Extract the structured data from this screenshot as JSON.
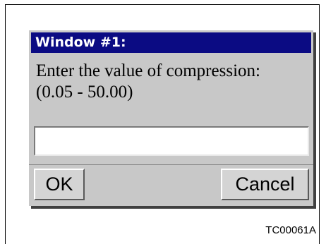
{
  "dialog": {
    "title": "Window #1:",
    "prompt_line1": "Enter the value of compression:",
    "prompt_line2": "(0.05 - 50.00)",
    "input_value": "",
    "ok_label": "OK",
    "cancel_label": "Cancel"
  },
  "figure": {
    "caption": "TC00061A"
  },
  "colors": {
    "titlebar": "#0b0b83",
    "dialog_bg": "#c8c8c8",
    "title_text": "#ffffff"
  }
}
